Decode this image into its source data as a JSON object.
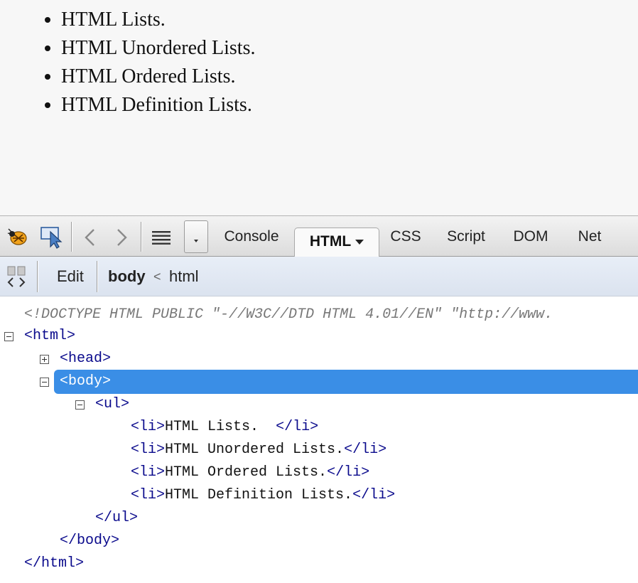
{
  "page": {
    "list_items": [
      "HTML Lists.",
      "HTML Unordered Lists.",
      "HTML Ordered Lists.",
      "HTML Definition Lists."
    ]
  },
  "toolbar": {
    "icons": [
      "firebug-icon",
      "inspect-icon",
      "back-icon",
      "forward-icon",
      "menu-icon",
      "dropdown-icon"
    ],
    "tabs": [
      {
        "label": "Console"
      },
      {
        "label": "HTML",
        "active": true
      },
      {
        "label": "CSS"
      },
      {
        "label": "Script"
      },
      {
        "label": "DOM"
      },
      {
        "label": "Net"
      }
    ]
  },
  "breadcrumb": {
    "edit_label": "Edit",
    "items": [
      "body",
      "<",
      "html"
    ]
  },
  "tree": {
    "doctype": "<!DOCTYPE HTML PUBLIC \"-//W3C//DTD HTML 4.01//EN\" \"http://www.",
    "html_open": "<html>",
    "head": "<head>",
    "body_open": "<body>",
    "ul_open": "<ul>",
    "li_open": "<li>",
    "li_close": "</li>",
    "li_items": [
      "HTML Lists. ",
      "HTML Unordered Lists.",
      "HTML Ordered Lists.",
      "HTML Definition Lists."
    ],
    "ul_close": "</ul>",
    "body_close": "</body>",
    "html_close": "</html>"
  },
  "colors": {
    "selection": "#3a8ee6",
    "tag": "#0a0a8c"
  }
}
